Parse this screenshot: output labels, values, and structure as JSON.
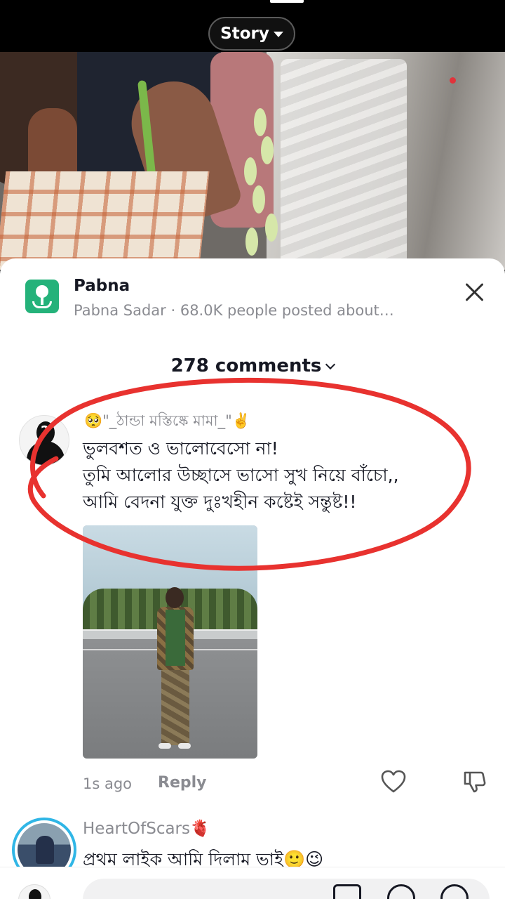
{
  "header": {
    "story_label": "Story"
  },
  "location": {
    "title": "Pabna",
    "subtitle": "Pabna Sadar · 68.0K people posted about…"
  },
  "comments_header": {
    "count_label": "278 comments"
  },
  "comments": [
    {
      "username": "🥺\"_ঠান্ডা মস্তিষ্কে মামা_\"✌️",
      "text": "ভুলবশত ও ভালোবেসো না!\nতুমি আলোর উচ্ছাসে ভাসো সুখ নিয়ে বাঁচো,,\nআমি বেদনা যুক্ত দুঃখহীন কষ্টেই সন্তুষ্ট!!",
      "time": "1s ago",
      "reply_label": "Reply",
      "has_image": true
    },
    {
      "username": "HeartOfScars🫀",
      "text": "প্রথম লাইক আমি দিলাম ভাই🙂😉"
    }
  ],
  "colors": {
    "accent_location": "#24b27a",
    "annotation": "#e8322f",
    "muted_text": "#8a8b91",
    "avatar_ring": "#30b6e6"
  },
  "icons": {
    "location": "map-pin-icon",
    "close": "close-icon",
    "like": "heart-icon",
    "dislike": "thumbs-down-icon"
  }
}
